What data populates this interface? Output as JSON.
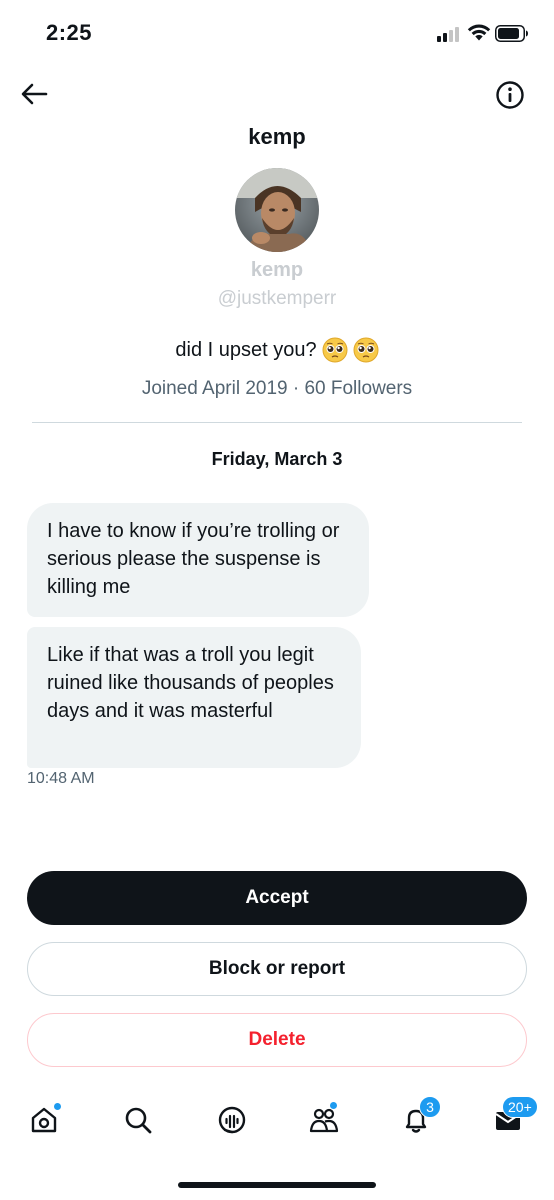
{
  "status_bar": {
    "time": "2:25"
  },
  "header": {
    "title": "kemp"
  },
  "profile": {
    "name": "kemp",
    "handle": "@justkemperr",
    "bio_text": "did I upset you?",
    "bio_emojis": [
      "pleading-face",
      "pleading-face"
    ],
    "meta": "Joined April 2019 · 60 Followers"
  },
  "conversation": {
    "date": "Friday, March 3",
    "messages": [
      {
        "text": "I have to know if you’re trolling or serious please the suspense is killing me"
      },
      {
        "text": "Like if that was a troll you legit ruined like thousands of peoples days and it was masterful"
      }
    ],
    "timestamp": "10:48 AM"
  },
  "actions": {
    "accept": "Accept",
    "block_report": "Block or report",
    "delete": "Delete"
  },
  "bottom_nav": {
    "items": [
      {
        "icon": "home-icon",
        "dot": true
      },
      {
        "icon": "search-icon"
      },
      {
        "icon": "spaces-icon"
      },
      {
        "icon": "communities-icon",
        "dot": true
      },
      {
        "icon": "bell-icon",
        "badge": "3"
      },
      {
        "icon": "messages-icon",
        "badge": "20+"
      }
    ]
  },
  "colors": {
    "accent": "#1d9bf0",
    "danger": "#f4212e",
    "bubble": "#eff3f4",
    "text": "#0f1419",
    "muted": "#536471"
  }
}
